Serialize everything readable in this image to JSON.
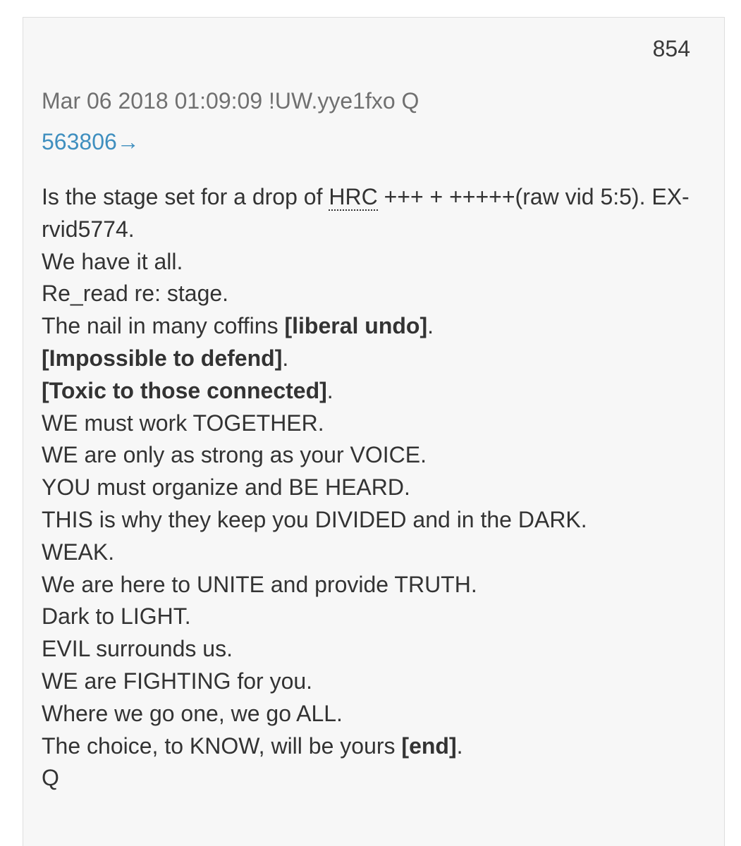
{
  "post": {
    "number": "854",
    "date": "Mar 06 2018 01:09:09",
    "author": "!UW.yye1fxo Q",
    "reply_link": "563806→",
    "lines": {
      "l1_a": "Is the stage set for a drop of ",
      "l1_abbr": "HRC",
      "l1_b": " +++ + +++++(raw vid 5:5). EX-rvid5774.",
      "l2": "We have it all.",
      "l3": "Re_read re: stage.",
      "l4_a": "The nail in many coffins ",
      "l4_bold": "[liberal undo]",
      "l4_b": ".",
      "l5_bold": "[Impossible to defend]",
      "l5_b": ".",
      "l6_bold": "[Toxic to those connected]",
      "l6_b": ".",
      "l7": "WE must work TOGETHER.",
      "l8": "WE are only as strong as your VOICE.",
      "l9": "YOU must organize and BE HEARD.",
      "l10": "THIS is why they keep you DIVIDED and in the DARK.",
      "l11": "WEAK.",
      "l12": "We are here to UNITE and provide TRUTH.",
      "l13": "Dark to LIGHT.",
      "l14": "EVIL surrounds us.",
      "l15": "WE are FIGHTING for you.",
      "l16": "Where we go one, we go ALL.",
      "l17_a": "The choice, to KNOW, will be yours ",
      "l17_bold": "[end]",
      "l17_b": ".",
      "l18": "Q"
    }
  }
}
